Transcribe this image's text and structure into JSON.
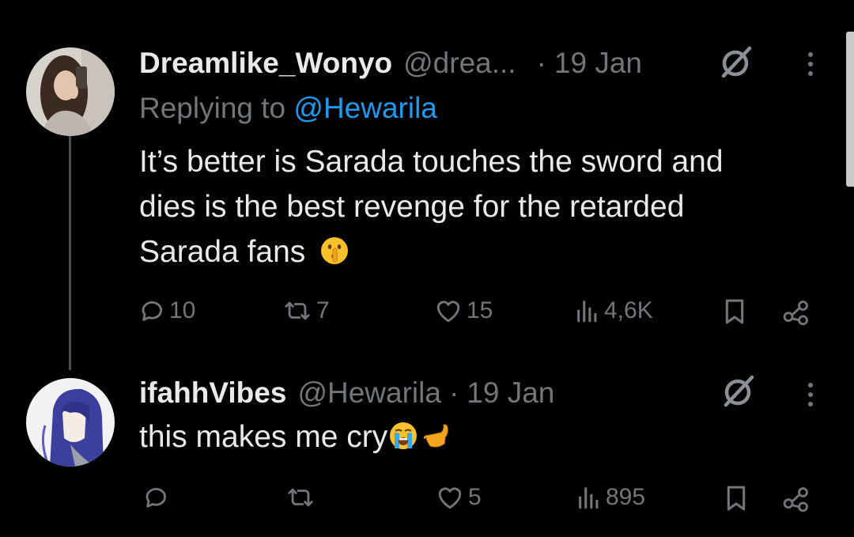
{
  "colors": {
    "background": "#000000",
    "text": "#e7e9ea",
    "muted": "#71767b",
    "link": "#1d9bf0"
  },
  "tweets": [
    {
      "display_name": "Dreamlike_Wonyo",
      "handle": "@drea...",
      "separator": "·",
      "date": "19 Jan",
      "replying_label": "Replying to ",
      "replying_handle": "@Hewarila",
      "text_lines": [
        "It’s better is Sarada touches the sword and",
        "dies is the best revenge for the retarded",
        "Sarada fans"
      ],
      "emojis": [
        "shushing-face"
      ],
      "actions": {
        "replies": "10",
        "reposts": "7",
        "likes": "15",
        "views": "4,6K"
      },
      "icons": [
        "grok-icon",
        "more-icon",
        "reply-icon",
        "repost-icon",
        "like-icon",
        "views-icon",
        "bookmark-icon",
        "share-icon"
      ]
    },
    {
      "display_name": "ifahhVibes",
      "handle": "@Hewarila",
      "separator": "·",
      "date": "19 Jan",
      "text_lines": [
        "this makes me cry"
      ],
      "emojis": [
        "loudly-crying-face",
        "call-me-hand"
      ],
      "actions": {
        "replies": "",
        "reposts": "",
        "likes": "5",
        "views": "895"
      },
      "icons": [
        "grok-icon",
        "more-icon",
        "reply-icon",
        "repost-icon",
        "like-icon",
        "views-icon",
        "bookmark-icon",
        "share-icon"
      ]
    }
  ]
}
